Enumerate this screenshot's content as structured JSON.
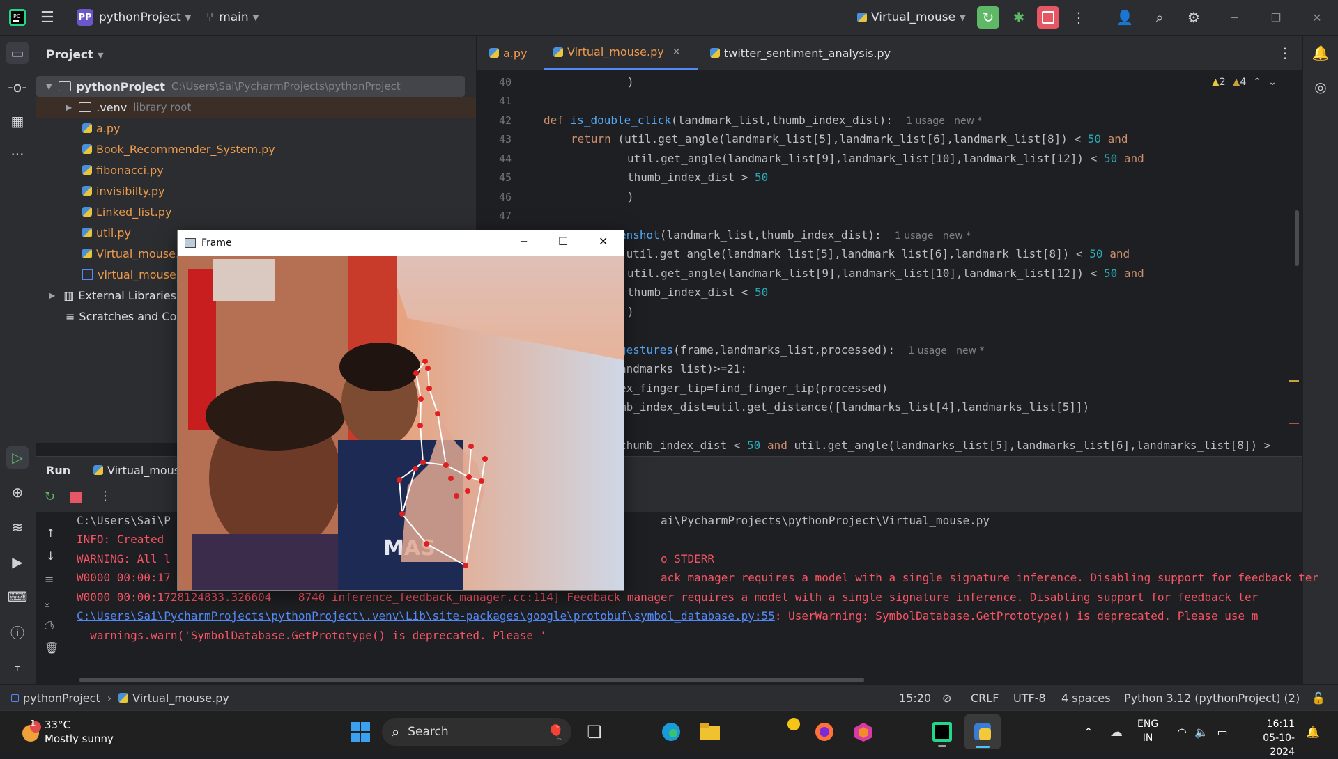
{
  "titlebar": {
    "project_badge": "PP",
    "project_name": "pythonProject",
    "branch": "main",
    "run_config": "Virtual_mouse"
  },
  "project_panel": {
    "title": "Project",
    "root_name": "pythonProject",
    "root_path": "C:\\Users\\Sai\\PycharmProjects\\pythonProject",
    "venv_name": ".venv",
    "venv_note": "library root",
    "files": [
      "a.py",
      "Book_Recommender_System.py",
      "fibonacci.py",
      "invisibilty.py",
      "Linked_list.py",
      "util.py",
      "Virtual_mouse.",
      "virtual_mouse_"
    ],
    "external_libraries": "External Libraries",
    "scratches": "Scratches and Co"
  },
  "editor": {
    "tabs": [
      "a.py",
      "Virtual_mouse.py",
      "twitter_sentiment_analysis.py"
    ],
    "active_tab": "Virtual_mouse.py",
    "warnings_a": "2",
    "warnings_b": "4",
    "line_numbers": [
      "40",
      "41",
      "42",
      "43",
      "44",
      "45",
      "46",
      "47"
    ],
    "lines": {
      "l40": ")",
      "l42_kw": "def",
      "l42_fn": "is_double_click",
      "l42_rest": "(landmark_list,thumb_index_dist):",
      "l42_hint": "1 usage   new *",
      "l43_kw": "return",
      "l43_rest": "(util.get_angle(landmark_list[5],landmark_list[6],landmark_list[8]) < ",
      "l43_num": "50",
      "l43_and": "and",
      "l44_rest": "util.get_angle(landmark_list[9],landmark_list[10],landmark_list[12]) < ",
      "l44_num": "50",
      "l44_and": "and",
      "l45_rest": "thumb_index_dist > ",
      "l45_num": "50",
      "l46": ")",
      "l48_fn": "enshot",
      "l48_rest": "(landmark_list,thumb_index_dist):",
      "l48_hint": "1 usage   new *",
      "l49_rest": "(util.get_angle(landmark_list[5],landmark_list[6],landmark_list[8]) < ",
      "l49_num": "50",
      "l49_and": "and",
      "l50_rest": "util.get_angle(landmark_list[9],landmark_list[10],landmark_list[12]) < ",
      "l50_num": "50",
      "l50_and": "and",
      "l51_rest": "thumb_index_dist < ",
      "l51_num": "50",
      "l52": ")",
      "l54_fn": "gestures",
      "l54_rest": "(frame,landmarks_list,processed):",
      "l54_hint": "1 usage   new *",
      "l55": "andmarks_list)>=21:",
      "l56": "ex_finger_tip=find_finger_tip(processed)",
      "l57": "mb_index_dist=util.get_distance([landmarks_list[4],landmarks_list[5]])",
      "l59a": "thumb_index_dist < ",
      "l59num": "50",
      "l59and": "and",
      "l59b": " util.get_angle(landmarks_list[5],landmarks_list[6],landmarks_list[8]) >"
    }
  },
  "run_panel": {
    "tab": "Run",
    "config": "Virtual_mous",
    "console": {
      "c1a": "C:\\Users\\Sai\\P",
      "c1b": "ai\\PycharmProjects\\pythonProject\\Virtual_mouse.py",
      "c2": "INFO: Created",
      "c3a": "WARNING: All l",
      "c3b": "o STDERR",
      "c4a": "W0000 00:00:17",
      "c4b": "ack manager requires a model with a single signature inference. Disabling support for feedback ter",
      "c5": "W0000 00:00:1728124833.326604    8740 inference_feedback_manager.cc:114] Feedback manager requires a model with a single signature inference. Disabling support for feedback ter",
      "c6_link": "C:\\Users\\Sai\\PycharmProjects\\pythonProject\\.venv\\Lib\\site-packages\\google\\protobuf\\symbol_database.py:55",
      "c6_rest": ": UserWarning: SymbolDatabase.GetPrototype() is deprecated. Please use m",
      "c7": "  warnings.warn('SymbolDatabase.GetPrototype() is deprecated. Please '"
    }
  },
  "statusbar": {
    "crumb1": "pythonProject",
    "crumb2": "Virtual_mouse.py",
    "position": "15:20",
    "line_sep": "CRLF",
    "encoding": "UTF-8",
    "indent": "4 spaces",
    "interpreter": "Python 3.12 (pythonProject) (2)"
  },
  "frame_window": {
    "title": "Frame",
    "shirt_text": "MAS"
  },
  "taskbar": {
    "weather_temp": "33°C",
    "weather_desc": "Mostly sunny",
    "weather_badge": "1",
    "search": "Search",
    "lang": "ENG",
    "region": "IN",
    "time": "16:11",
    "date": "05-10-2024"
  },
  "colors": {
    "ide_bg": "#1e1f22",
    "panel_bg": "#2b2d30",
    "accent": "#548af7",
    "stop_red": "#e55765",
    "run_green": "#5fb865"
  }
}
